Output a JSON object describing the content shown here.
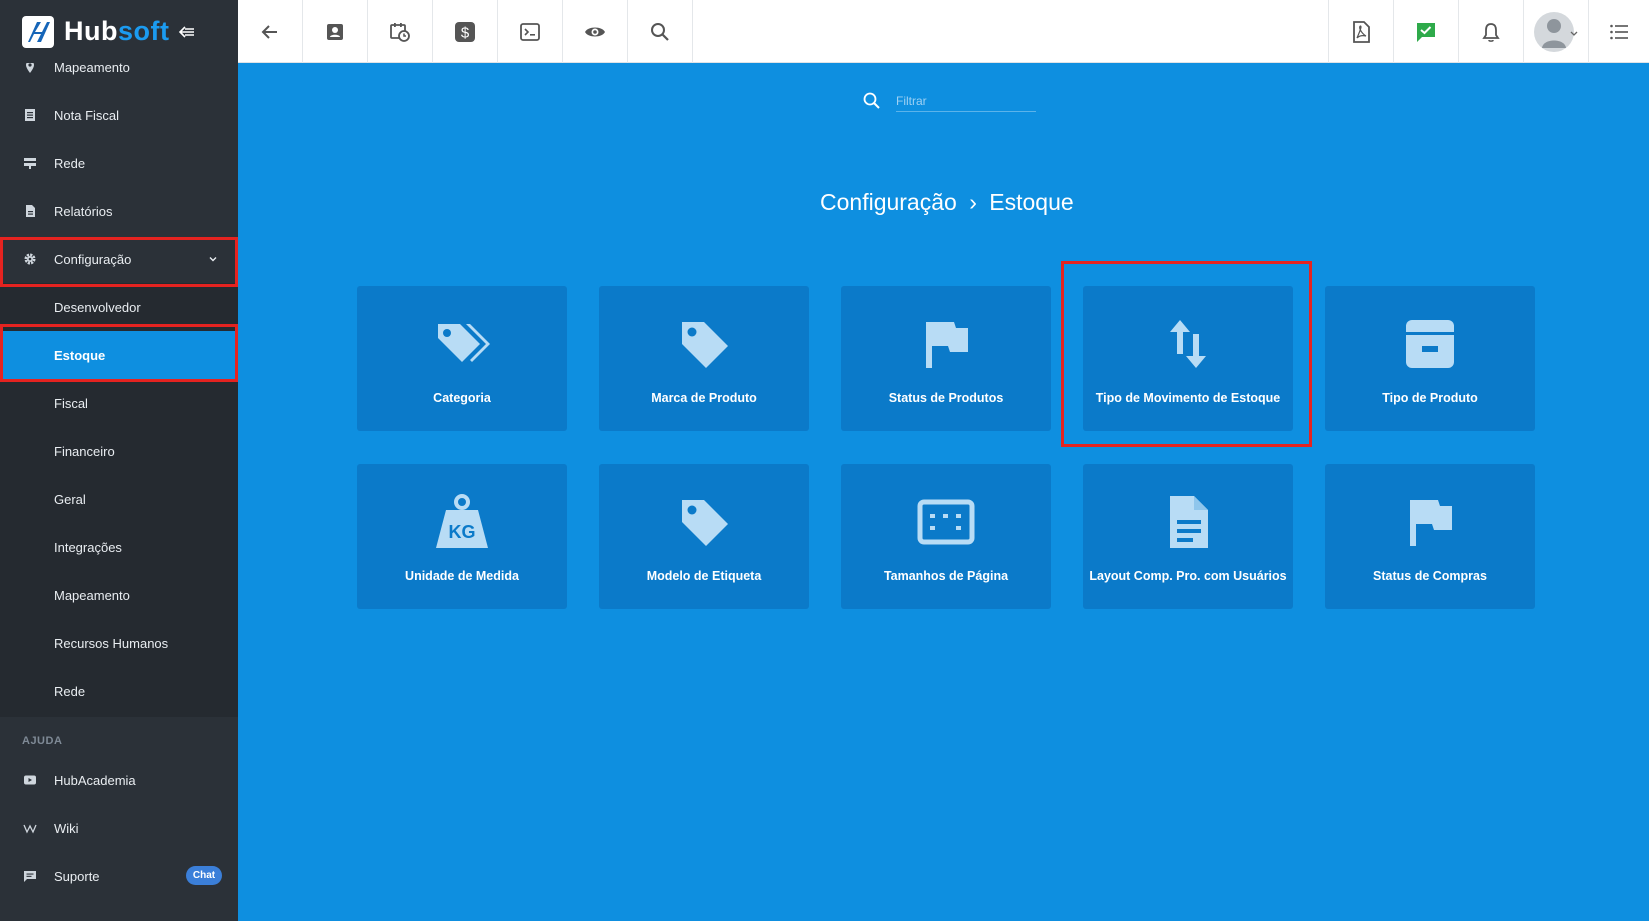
{
  "brand": {
    "word_a": "Hub",
    "word_b": "soft"
  },
  "sidebar": {
    "items": [
      {
        "label": "Mapeamento",
        "icon": "map-pin-icon"
      },
      {
        "label": "Nota Fiscal",
        "icon": "receipt-icon"
      },
      {
        "label": "Rede",
        "icon": "network-icon"
      },
      {
        "label": "Relatórios",
        "icon": "report-icon"
      },
      {
        "label": "Configuração",
        "icon": "gear-icon"
      }
    ],
    "submenu": [
      {
        "label": "Desenvolvedor"
      },
      {
        "label": "Estoque"
      },
      {
        "label": "Fiscal"
      },
      {
        "label": "Financeiro"
      },
      {
        "label": "Geral"
      },
      {
        "label": "Integrações"
      },
      {
        "label": "Mapeamento"
      },
      {
        "label": "Recursos Humanos"
      },
      {
        "label": "Rede"
      }
    ],
    "help_heading": "AJUDA",
    "help_items": [
      {
        "label": "HubAcademia",
        "icon": "video-icon"
      },
      {
        "label": "Wiki",
        "icon": "wikipedia-icon"
      },
      {
        "label": "Suporte",
        "icon": "chat-icon",
        "badge": "Chat"
      }
    ]
  },
  "topbar": {
    "left_icons": [
      "back-arrow-icon",
      "contact-card-icon",
      "calendar-clock-icon",
      "dollar-icon",
      "terminal-icon",
      "eye-icon",
      "search-icon"
    ],
    "right_icons": [
      "pdf-icon",
      "check-message-icon",
      "bell-icon",
      "avatar",
      "list-icon"
    ]
  },
  "filter": {
    "placeholder": "Filtrar"
  },
  "breadcrumb": {
    "parent": "Configuração",
    "separator": "›",
    "current": "Estoque"
  },
  "tiles": [
    {
      "label": "Categoria",
      "icon": "tags-icon"
    },
    {
      "label": "Marca de Produto",
      "icon": "tag-icon"
    },
    {
      "label": "Status de Produtos",
      "icon": "flag-icon"
    },
    {
      "label": "Tipo de Movimento de Estoque",
      "icon": "swap-vertical-icon"
    },
    {
      "label": "Tipo de Produto",
      "icon": "archive-box-icon"
    },
    {
      "label": "Unidade de Medida",
      "icon": "weight-kg-icon"
    },
    {
      "label": "Modelo de Etiqueta",
      "icon": "tag-icon"
    },
    {
      "label": "Tamanhos de Página",
      "icon": "page-size-icon"
    },
    {
      "label": "Layout Comp. Pro. com Usuários",
      "icon": "document-icon"
    },
    {
      "label": "Status de Compras",
      "icon": "flag-icon"
    }
  ],
  "colors": {
    "accent": "#0e8fe0",
    "tile": "#0b7ac9",
    "sidebar": "#2b3138",
    "highlight": "#e52320"
  }
}
